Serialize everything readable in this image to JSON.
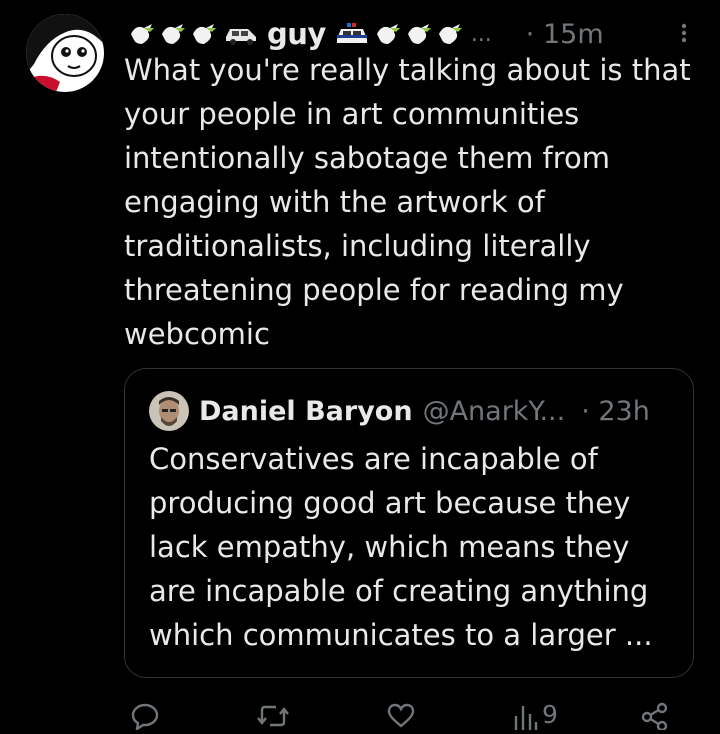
{
  "tweet": {
    "display_name": "guy",
    "name_emojis_before": [
      "dove-icon",
      "dove-icon",
      "dove-icon",
      "car-icon"
    ],
    "name_emojis_after": [
      "police-car-icon",
      "dove-icon",
      "dove-icon",
      "dove-icon"
    ],
    "truncation": "...",
    "time": "· 15m",
    "text": "What you're really talking about is that your people in art communities intentionally sabotage them from engaging with the artwork of traditionalists, including literally threatening people for reading my webcomic"
  },
  "quote": {
    "name": "Daniel Baryon",
    "handle": "@AnarkY...",
    "time": "· 23h",
    "text": "Conservatives are incapable of producing good art because they lack empathy, which means they are incapable of creating anything which communicates to a larger ..."
  },
  "actions": {
    "reply": {
      "icon": "reply-icon",
      "count": ""
    },
    "retweet": {
      "icon": "retweet-icon",
      "count": ""
    },
    "like": {
      "icon": "heart-icon",
      "count": ""
    },
    "views": {
      "icon": "views-icon",
      "count": "9"
    },
    "share": {
      "icon": "share-icon",
      "count": ""
    }
  },
  "colors": {
    "background": "#000000",
    "text": "#e7e9ea",
    "secondary": "#71767b",
    "border": "#2f3336"
  }
}
